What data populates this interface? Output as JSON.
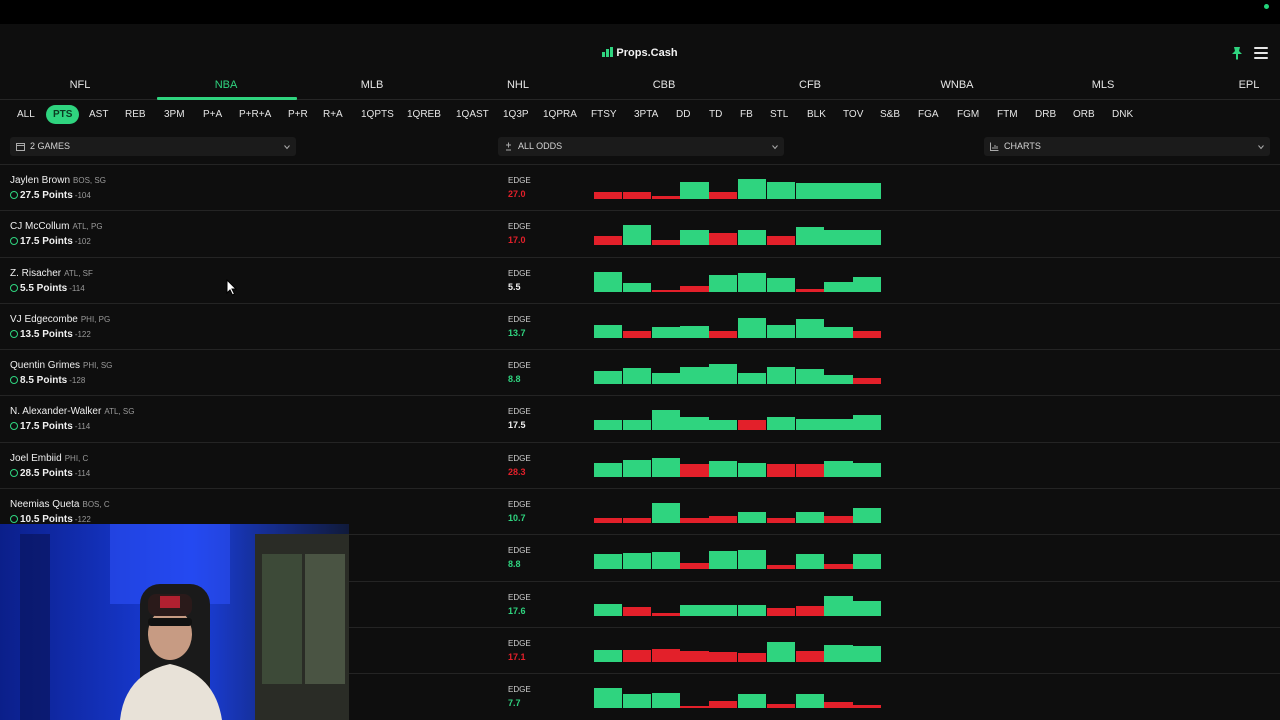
{
  "app": {
    "title": "Props.Cash"
  },
  "colors": {
    "accent": "#2fd47f",
    "loss": "#e3202a",
    "background": "#0e0e0e"
  },
  "header": {
    "logo_icon": "bar-chart-icon",
    "pin_icon": "pin-icon",
    "menu_icon": "hamburger-menu-icon"
  },
  "leagues": [
    "NFL",
    "NBA",
    "MLB",
    "NHL",
    "CBB",
    "CFB",
    "WNBA",
    "MLS",
    "EPL"
  ],
  "active_league": "NBA",
  "stats": [
    "ALL",
    "PTS",
    "AST",
    "REB",
    "3PM",
    "P+A",
    "P+R+A",
    "P+R",
    "R+A",
    "1QPTS",
    "1QREB",
    "1QAST",
    "1Q3P",
    "1QPRA",
    "FTSY",
    "3PTA",
    "DD",
    "TD",
    "FB",
    "STL",
    "BLK",
    "TOV",
    "S&B",
    "FGA",
    "FGM",
    "FTM",
    "DRB",
    "ORB",
    "DNK"
  ],
  "active_stat": "PTS",
  "filters": {
    "games": {
      "label": "2 GAMES",
      "icon": "calendar-icon"
    },
    "odds": {
      "label": "ALL ODDS",
      "icon": "plus-minus-icon"
    },
    "view": {
      "label": "CHARTS",
      "icon": "bar-chart-icon"
    }
  },
  "edge_label": "EDGE",
  "players": [
    {
      "name": "Jaylen Brown",
      "meta": "BOS, SG",
      "line": "27.5 Points",
      "odds": "-104",
      "edge": "27.0",
      "edge_color": "red",
      "bars": [
        {
          "v": 0.35,
          "h": 0
        },
        {
          "v": 0.35,
          "h": 0
        },
        {
          "v": 0.15,
          "h": 0
        },
        {
          "v": 0.85,
          "h": 1
        },
        {
          "v": 0.35,
          "h": 0
        },
        {
          "v": 1.0,
          "h": 1
        },
        {
          "v": 0.85,
          "h": 1
        },
        {
          "v": 0.8,
          "h": 1
        },
        {
          "v": 0.8,
          "h": 1
        },
        {
          "v": 0.8,
          "h": 1
        }
      ]
    },
    {
      "name": "CJ McCollum",
      "meta": "ATL, PG",
      "line": "17.5 Points",
      "odds": "-102",
      "edge": "17.0",
      "edge_color": "red",
      "bars": [
        {
          "v": 0.45,
          "h": 0
        },
        {
          "v": 1.0,
          "h": 1
        },
        {
          "v": 0.25,
          "h": 0
        },
        {
          "v": 0.75,
          "h": 1
        },
        {
          "v": 0.6,
          "h": 0
        },
        {
          "v": 0.75,
          "h": 1
        },
        {
          "v": 0.45,
          "h": 0
        },
        {
          "v": 0.9,
          "h": 1
        },
        {
          "v": 0.75,
          "h": 1
        },
        {
          "v": 0.75,
          "h": 1
        }
      ]
    },
    {
      "name": "Z. Risacher",
      "meta": "ATL, SF",
      "line": "5.5 Points",
      "odds": "-114",
      "edge": "5.5",
      "edge_color": "white",
      "bars": [
        {
          "v": 1.0,
          "h": 1
        },
        {
          "v": 0.45,
          "h": 1
        },
        {
          "v": 0.1,
          "h": 0
        },
        {
          "v": 0.3,
          "h": 0
        },
        {
          "v": 0.85,
          "h": 1
        },
        {
          "v": 0.95,
          "h": 1
        },
        {
          "v": 0.7,
          "h": 1
        },
        {
          "v": 0.15,
          "h": 0
        },
        {
          "v": 0.5,
          "h": 1
        },
        {
          "v": 0.75,
          "h": 1
        }
      ]
    },
    {
      "name": "VJ Edgecombe",
      "meta": "PHI, PG",
      "line": "13.5 Points",
      "odds": "-122",
      "edge": "13.7",
      "edge_color": "green",
      "bars": [
        {
          "v": 0.65,
          "h": 1
        },
        {
          "v": 0.35,
          "h": 0
        },
        {
          "v": 0.55,
          "h": 1
        },
        {
          "v": 0.6,
          "h": 1
        },
        {
          "v": 0.35,
          "h": 0
        },
        {
          "v": 1.0,
          "h": 1
        },
        {
          "v": 0.65,
          "h": 1
        },
        {
          "v": 0.95,
          "h": 1
        },
        {
          "v": 0.55,
          "h": 1
        },
        {
          "v": 0.35,
          "h": 0
        }
      ]
    },
    {
      "name": "Quentin Grimes",
      "meta": "PHI, SG",
      "line": "8.5 Points",
      "odds": "-128",
      "edge": "8.8",
      "edge_color": "green",
      "bars": [
        {
          "v": 0.65,
          "h": 1
        },
        {
          "v": 0.8,
          "h": 1
        },
        {
          "v": 0.55,
          "h": 1
        },
        {
          "v": 0.85,
          "h": 1
        },
        {
          "v": 1.0,
          "h": 1
        },
        {
          "v": 0.55,
          "h": 1
        },
        {
          "v": 0.85,
          "h": 1
        },
        {
          "v": 0.75,
          "h": 1
        },
        {
          "v": 0.45,
          "h": 1
        },
        {
          "v": 0.3,
          "h": 0
        }
      ]
    },
    {
      "name": "N. Alexander-Walker",
      "meta": "ATL, SG",
      "line": "17.5 Points",
      "odds": "-114",
      "edge": "17.5",
      "edge_color": "white",
      "bars": [
        {
          "v": 0.5,
          "h": 1
        },
        {
          "v": 0.5,
          "h": 1
        },
        {
          "v": 1.0,
          "h": 1
        },
        {
          "v": 0.65,
          "h": 1
        },
        {
          "v": 0.5,
          "h": 1
        },
        {
          "v": 0.5,
          "h": 0
        },
        {
          "v": 0.65,
          "h": 1
        },
        {
          "v": 0.55,
          "h": 1
        },
        {
          "v": 0.55,
          "h": 1
        },
        {
          "v": 0.75,
          "h": 1
        }
      ]
    },
    {
      "name": "Joel Embiid",
      "meta": "PHI, C",
      "line": "28.5 Points",
      "odds": "-114",
      "edge": "28.3",
      "edge_color": "red",
      "bars": [
        {
          "v": 0.7,
          "h": 1
        },
        {
          "v": 0.85,
          "h": 1
        },
        {
          "v": 0.95,
          "h": 1
        },
        {
          "v": 0.65,
          "h": 0
        },
        {
          "v": 0.8,
          "h": 1
        },
        {
          "v": 0.7,
          "h": 1
        },
        {
          "v": 0.65,
          "h": 0
        },
        {
          "v": 0.65,
          "h": 0
        },
        {
          "v": 0.8,
          "h": 1
        },
        {
          "v": 0.7,
          "h": 1
        }
      ]
    },
    {
      "name": "Neemias Queta",
      "meta": "BOS, C",
      "line": "10.5 Points",
      "odds": "-122",
      "edge": "10.7",
      "edge_color": "green",
      "bars": [
        {
          "v": 0.25,
          "h": 0
        },
        {
          "v": 0.25,
          "h": 0
        },
        {
          "v": 1.0,
          "h": 1
        },
        {
          "v": 0.25,
          "h": 0
        },
        {
          "v": 0.35,
          "h": 0
        },
        {
          "v": 0.55,
          "h": 1
        },
        {
          "v": 0.25,
          "h": 0
        },
        {
          "v": 0.55,
          "h": 1
        },
        {
          "v": 0.35,
          "h": 0
        },
        {
          "v": 0.75,
          "h": 1
        }
      ]
    },
    {
      "name": "",
      "meta": "",
      "line": "",
      "odds": "",
      "edge": "8.8",
      "edge_color": "green",
      "bars": [
        {
          "v": 0.75,
          "h": 1
        },
        {
          "v": 0.8,
          "h": 1
        },
        {
          "v": 0.85,
          "h": 1
        },
        {
          "v": 0.3,
          "h": 0
        },
        {
          "v": 0.9,
          "h": 1
        },
        {
          "v": 0.95,
          "h": 1
        },
        {
          "v": 0.2,
          "h": 0
        },
        {
          "v": 0.75,
          "h": 1
        },
        {
          "v": 0.25,
          "h": 0
        },
        {
          "v": 0.75,
          "h": 1
        }
      ]
    },
    {
      "name": "",
      "meta": "",
      "line": "",
      "odds": "",
      "edge": "17.6",
      "edge_color": "green",
      "bars": [
        {
          "v": 0.6,
          "h": 1
        },
        {
          "v": 0.45,
          "h": 0
        },
        {
          "v": 0.15,
          "h": 0
        },
        {
          "v": 0.55,
          "h": 1
        },
        {
          "v": 0.55,
          "h": 1
        },
        {
          "v": 0.55,
          "h": 1
        },
        {
          "v": 0.4,
          "h": 0
        },
        {
          "v": 0.5,
          "h": 0
        },
        {
          "v": 1.0,
          "h": 1
        },
        {
          "v": 0.75,
          "h": 1
        }
      ]
    },
    {
      "name": "",
      "meta": "",
      "line": "",
      "odds": "",
      "edge": "17.1",
      "edge_color": "red",
      "bars": [
        {
          "v": 0.6,
          "h": 1
        },
        {
          "v": 0.6,
          "h": 0
        },
        {
          "v": 0.65,
          "h": 0
        },
        {
          "v": 0.55,
          "h": 0
        },
        {
          "v": 0.5,
          "h": 0
        },
        {
          "v": 0.45,
          "h": 0
        },
        {
          "v": 1.0,
          "h": 1
        },
        {
          "v": 0.55,
          "h": 0
        },
        {
          "v": 0.85,
          "h": 1
        },
        {
          "v": 0.8,
          "h": 1
        }
      ]
    },
    {
      "name": "",
      "meta": "",
      "line": "",
      "odds": "",
      "edge": "7.7",
      "edge_color": "green",
      "bars": [
        {
          "v": 1.0,
          "h": 1
        },
        {
          "v": 0.7,
          "h": 1
        },
        {
          "v": 0.75,
          "h": 1
        },
        {
          "v": 0.1,
          "h": 0
        },
        {
          "v": 0.35,
          "h": 0
        },
        {
          "v": 0.7,
          "h": 1
        },
        {
          "v": 0.2,
          "h": 0
        },
        {
          "v": 0.7,
          "h": 1
        },
        {
          "v": 0.3,
          "h": 0
        },
        {
          "v": 0.15,
          "h": 0
        }
      ]
    }
  ],
  "webcam": {
    "label": "streamer-webcam"
  }
}
